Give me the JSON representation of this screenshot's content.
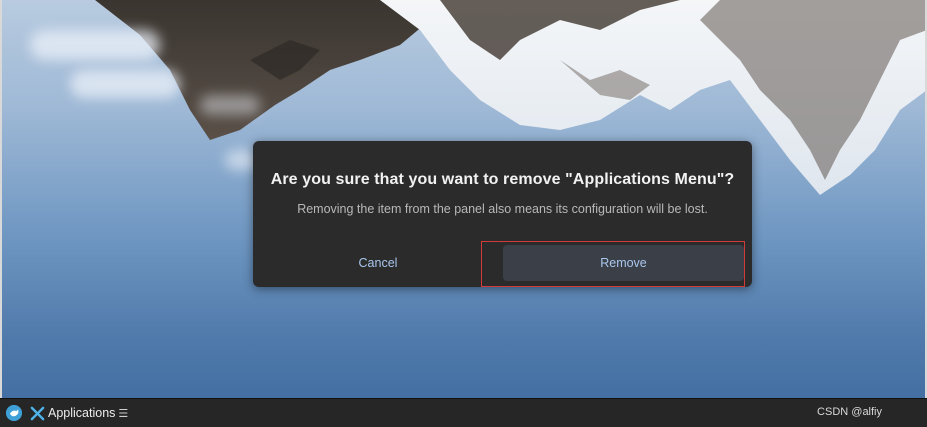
{
  "dialog": {
    "title": "Are you sure that you want to remove \"Applications Menu\"?",
    "message": "Removing the item from the panel also means its configuration will be lost.",
    "cancel_label": "Cancel",
    "remove_label": "Remove"
  },
  "panel": {
    "menu_label": "Applications",
    "menu_trailing": "☰",
    "credit": "CSDN @alfiy"
  },
  "colors": {
    "dialog_bg": "#2b2b2b",
    "button_text": "#a9c7ee",
    "highlight": "#d03a3a",
    "panel_bg": "#262626"
  },
  "icons": {
    "panel_logo": "distro-logo-icon",
    "apps_menu": "applications-menu-icon"
  }
}
